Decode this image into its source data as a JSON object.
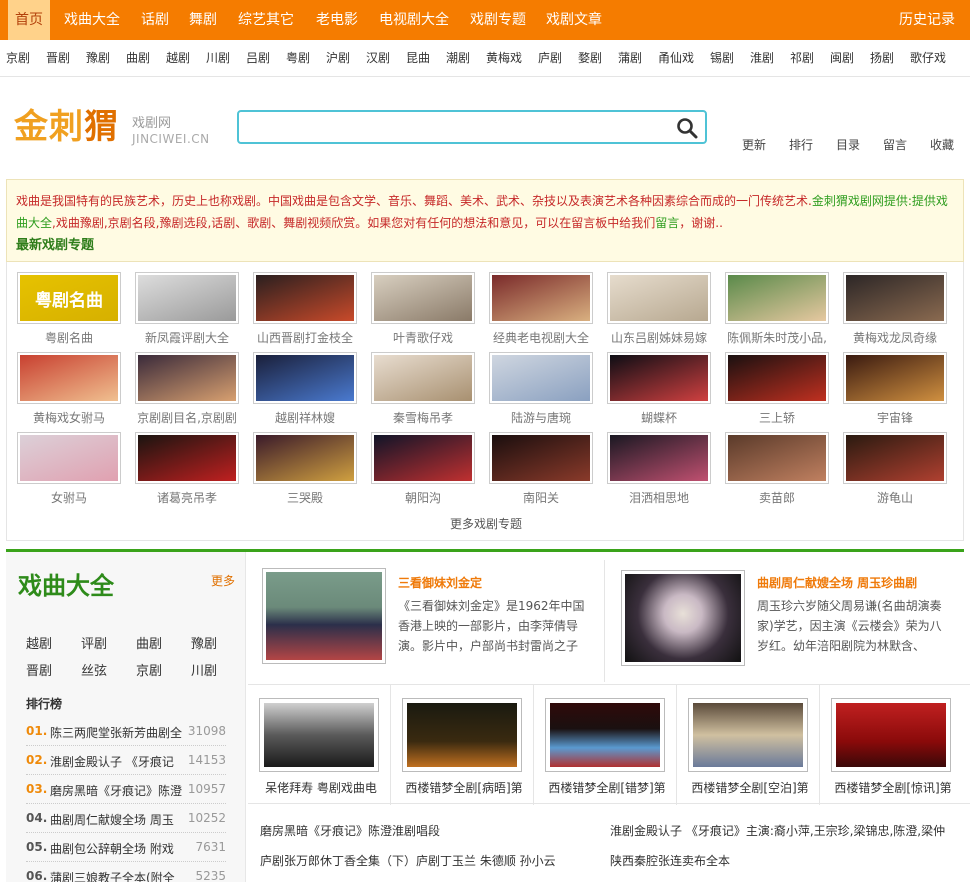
{
  "nav": {
    "items": [
      "首页",
      "戏曲大全",
      "话剧",
      "舞剧",
      "综艺其它",
      "老电影",
      "电视剧大全",
      "戏剧专题",
      "戏剧文章"
    ],
    "history": "历史记录"
  },
  "categories": [
    "京剧",
    "晋剧",
    "豫剧",
    "曲剧",
    "越剧",
    "川剧",
    "吕剧",
    "粤剧",
    "沪剧",
    "汉剧",
    "昆曲",
    "潮剧",
    "黄梅戏",
    "庐剧",
    "婺剧",
    "蒲剧",
    "甬仙戏",
    "锡剧",
    "淮剧",
    "祁剧",
    "闽剧",
    "扬剧",
    "歌仔戏"
  ],
  "logo": {
    "main_a": "金刺",
    "main_b": "猬",
    "sub1": "戏剧网",
    "sub2": "JINCIWEI.CN"
  },
  "search": {
    "value": "",
    "placeholder": ""
  },
  "top_links": [
    "更新",
    "排行",
    "目录",
    "留言",
    "收藏"
  ],
  "notice": {
    "text_a": "戏曲是我国特有的民族艺术，历史上也称戏剧。中国戏曲是包含文学、音乐、舞蹈、美术、武术、杂技以及表演艺术各种因素综合而成的一门传统艺术.",
    "brand": "金刺猬戏剧网提供:提供戏曲大全",
    "text_b": ",戏曲豫剧,京剧名段,豫剧选段,话剧、歌剧、舞剧视频欣赏。如果您对有任何的想法和意见，可以在留言板中给我们",
    "msg": "留言",
    "text_c": "，谢谢..",
    "title": "最新戏剧专题"
  },
  "topics": [
    "粤剧名曲",
    "新凤霞评剧大全",
    "山西晋剧打金枝全",
    "叶青歌仔戏",
    "经典老电视剧大全",
    "山东吕剧姊妹易嫁",
    "陈佩斯朱时茂小品,",
    "黄梅戏龙凤奇缘",
    "黄梅戏女驸马",
    "京剧剧目名,京剧剧",
    "越剧祥林嫂",
    "秦雪梅吊孝",
    "陆游与唐琬",
    "蝴蝶杯",
    "三上轿",
    "宇宙锋",
    "女驸马",
    "诸葛亮吊孝",
    "三哭殿",
    "朝阳沟",
    "南阳关",
    "泪洒相思地",
    "卖苗郎",
    "游龟山"
  ],
  "topic_badge": "粤剧名曲",
  "more_topics": "更多戏剧专题",
  "left": {
    "title": "戏曲大全",
    "more": "更多",
    "cats": [
      "越剧",
      "评剧",
      "曲剧",
      "豫剧",
      "晋剧",
      "丝弦",
      "京剧",
      "川剧"
    ],
    "rank_title": "排行榜",
    "ranks": [
      {
        "n": "01.",
        "t": "陈三两爬堂张新芳曲剧全",
        "c": "31098"
      },
      {
        "n": "02.",
        "t": "淮剧金殿认子 《牙痕记",
        "c": "14153"
      },
      {
        "n": "03.",
        "t": "磨房黑暗《牙痕记》陈澄",
        "c": "10957"
      },
      {
        "n": "04.",
        "t": "曲剧周仁献嫂全场 周玉",
        "c": "10252"
      },
      {
        "n": "05.",
        "t": "曲剧包公辞朝全场 附戏",
        "c": "7631"
      },
      {
        "n": "06.",
        "t": "蒲剧三娘教子全本(附全",
        "c": "5235"
      }
    ]
  },
  "features": [
    {
      "title": "三看御妹刘金定",
      "desc": "《三看御妹刘金定》是1962年中国香港上映的一部影片，由李萍倩导演。影片中，户部尚书封雷尚之子"
    },
    {
      "title": "曲剧周仁献嫂全场 周玉珍曲剧",
      "desc": "周玉珍六岁随父周易谦(名曲胡演奏家)学艺，因主演《云楼会》荣为八岁红。幼年涪阳剧院为林默含、"
    }
  ],
  "thumbs": [
    "呆佬拜寿 粤剧戏曲电",
    "西楼错梦全剧[病晤]第",
    "西楼错梦全剧[错梦]第",
    "西楼错梦全剧[空泊]第",
    "西楼错梦全剧[惊讯]第"
  ],
  "links": [
    "磨房黑暗《牙痕记》陈澄淮剧唱段",
    "淮剧金殿认子 《牙痕记》主演:裔小萍,王宗珍,梁锦忠,陈澄,梁仲",
    "庐剧张万郎休丁香全集（下）庐剧丁玉兰 朱德顺 孙小云",
    "陕西秦腔张连卖布全本"
  ]
}
